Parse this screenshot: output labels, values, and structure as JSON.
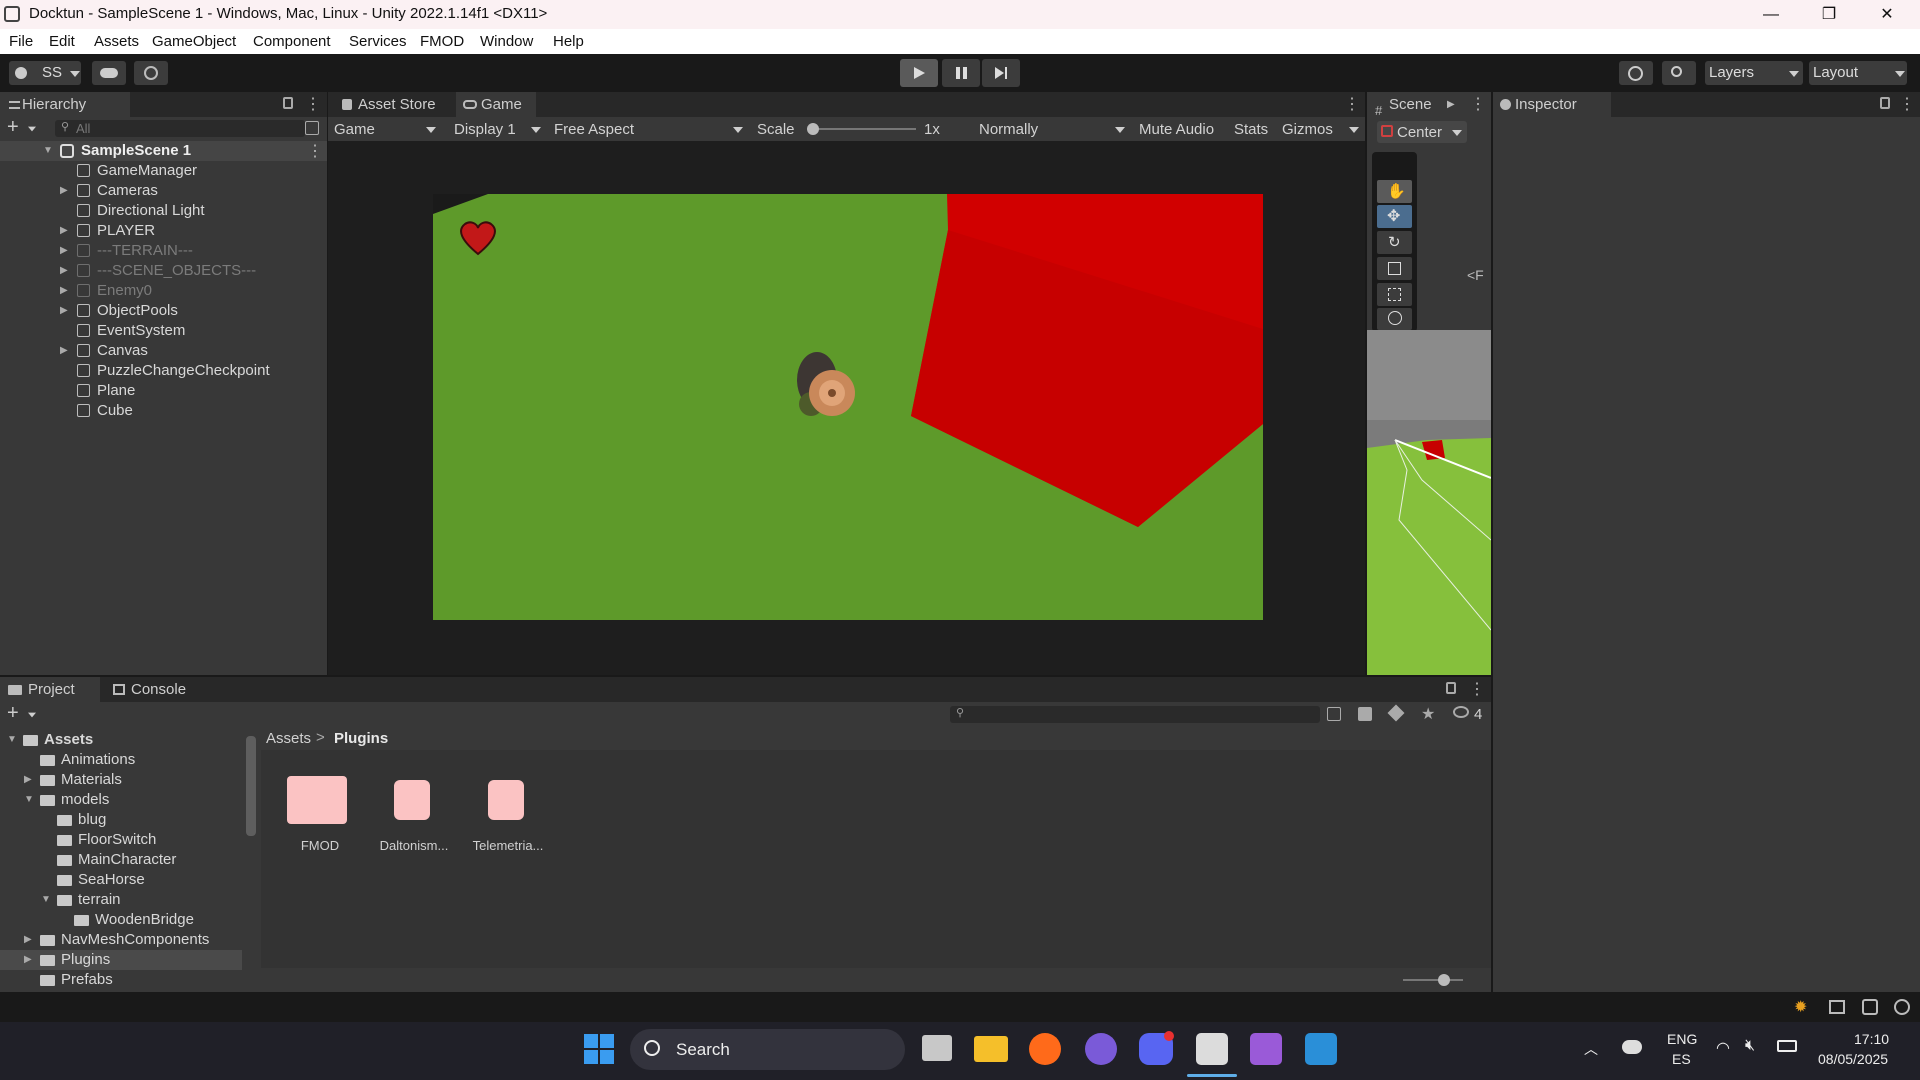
{
  "window": {
    "title": "Docktun - SampleScene 1 - Windows, Mac, Linux - Unity 2022.1.14f1 <DX11>",
    "controls": [
      "—",
      "❐",
      "✕"
    ]
  },
  "menu": [
    "File",
    "Edit",
    "Assets",
    "GameObject",
    "Component",
    "Services",
    "FMOD",
    "Window",
    "Help"
  ],
  "toolbar": {
    "account": "SS",
    "layers": "Layers",
    "layout": "Layout"
  },
  "hierarchy": {
    "tab": "Hierarchy",
    "search_placeholder": "All",
    "scene": "SampleScene 1",
    "items": [
      {
        "label": "GameManager",
        "expandable": false,
        "dim": false
      },
      {
        "label": "Cameras",
        "expandable": true,
        "dim": false
      },
      {
        "label": "Directional Light",
        "expandable": false,
        "dim": false
      },
      {
        "label": "PLAYER",
        "expandable": true,
        "dim": false
      },
      {
        "label": "---TERRAIN---",
        "expandable": true,
        "dim": true
      },
      {
        "label": "---SCENE_OBJECTS---",
        "expandable": true,
        "dim": true
      },
      {
        "label": "Enemy0",
        "expandable": true,
        "dim": true
      },
      {
        "label": "ObjectPools",
        "expandable": true,
        "dim": false
      },
      {
        "label": "EventSystem",
        "expandable": false,
        "dim": false
      },
      {
        "label": "Canvas",
        "expandable": true,
        "dim": false
      },
      {
        "label": "PuzzleChangeCheckpoint",
        "expandable": false,
        "dim": false
      },
      {
        "label": "Plane",
        "expandable": false,
        "dim": false
      },
      {
        "label": "Cube",
        "expandable": false,
        "dim": false
      }
    ]
  },
  "game": {
    "tabs": [
      "Asset Store",
      "Game"
    ],
    "mode": "Game",
    "display": "Display 1",
    "aspect": "Free Aspect",
    "scale_label": "Scale",
    "scale_value": "1x",
    "vsync": "Normally",
    "mute": "Mute Audio",
    "stats": "Stats",
    "gizmos": "Gizmos"
  },
  "scene": {
    "tab": "Scene",
    "pivot": "Center"
  },
  "inspector": {
    "tab": "Inspector"
  },
  "project": {
    "tabs": [
      "Project",
      "Console"
    ],
    "badge": "4",
    "tree": [
      {
        "label": "Assets",
        "indent": 0,
        "arrow": "open",
        "bold": true
      },
      {
        "label": "Animations",
        "indent": 1,
        "arrow": "none"
      },
      {
        "label": "Materials",
        "indent": 1,
        "arrow": "closed"
      },
      {
        "label": "models",
        "indent": 1,
        "arrow": "open"
      },
      {
        "label": "blug",
        "indent": 2,
        "arrow": "none"
      },
      {
        "label": "FloorSwitch",
        "indent": 2,
        "arrow": "none"
      },
      {
        "label": "MainCharacter",
        "indent": 2,
        "arrow": "none"
      },
      {
        "label": "SeaHorse",
        "indent": 2,
        "arrow": "none"
      },
      {
        "label": "terrain",
        "indent": 2,
        "arrow": "open"
      },
      {
        "label": "WoodenBridge",
        "indent": 3,
        "arrow": "none"
      },
      {
        "label": "NavMeshComponents",
        "indent": 1,
        "arrow": "closed"
      },
      {
        "label": "Plugins",
        "indent": 1,
        "arrow": "closed",
        "selected": true
      },
      {
        "label": "Prefabs",
        "indent": 1,
        "arrow": "none"
      }
    ],
    "breadcrumb": [
      "Assets",
      "Plugins"
    ],
    "files": [
      {
        "label": "FMOD",
        "kind": "folder"
      },
      {
        "label": "Daltonism...",
        "kind": "plugin"
      },
      {
        "label": "Telemetria...",
        "kind": "plugin"
      }
    ]
  },
  "taskbar": {
    "search": "Search",
    "lang1": "ENG",
    "lang2": "ES",
    "time": "17:10",
    "date": "08/05/2025"
  },
  "colors": {
    "ground": "#5e9a2a",
    "cube": "#d10000",
    "panel": "#383838",
    "selection": "#2c5d87"
  }
}
